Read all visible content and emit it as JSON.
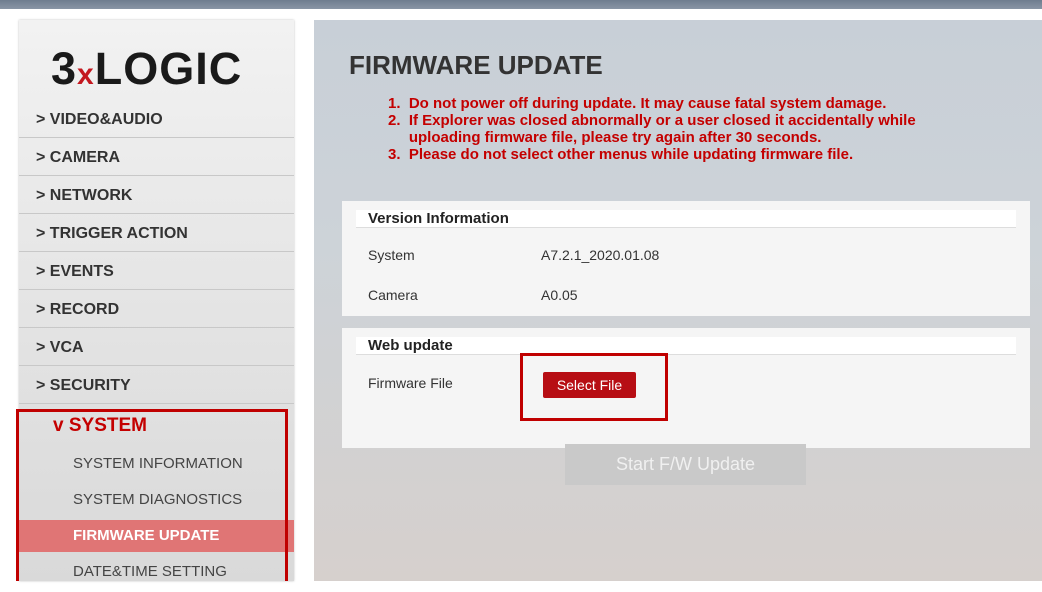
{
  "brand": {
    "logo_prefix": "3",
    "logo_x": "x",
    "logo_suffix": "LOGIC"
  },
  "sidebar": {
    "items": [
      {
        "label": "> VIDEO&AUDIO"
      },
      {
        "label": "> CAMERA"
      },
      {
        "label": "> NETWORK"
      },
      {
        "label": "> TRIGGER ACTION"
      },
      {
        "label": "> EVENTS"
      },
      {
        "label": "> RECORD"
      },
      {
        "label": "> VCA"
      },
      {
        "label": "> SECURITY"
      }
    ],
    "open_item": {
      "label": "v SYSTEM"
    },
    "sub_items": [
      {
        "label": "SYSTEM INFORMATION"
      },
      {
        "label": "SYSTEM DIAGNOSTICS"
      },
      {
        "label": "FIRMWARE UPDATE"
      },
      {
        "label": "DATE&TIME SETTING"
      }
    ],
    "active_sub_item": "FIRMWARE UPDATE"
  },
  "main": {
    "title": "FIRMWARE UPDATE",
    "notes": [
      "1.  Do not power off during update. It may cause fatal system damage.",
      "2.  If Explorer was closed abnormally or a user closed it accidentally while",
      "     uploading firmware file, please try again after 30 seconds.",
      "3.  Please do not select other menus while updating firmware file."
    ],
    "version_panel": {
      "header": "Version Information",
      "rows": [
        {
          "label": "System",
          "value": "A7.2.1_2020.01.08"
        },
        {
          "label": "Camera",
          "value": "A0.05"
        }
      ]
    },
    "web_update_panel": {
      "header": "Web update",
      "field_label": "Firmware File",
      "select_button": "Select File"
    },
    "start_button": "Start F/W Update"
  },
  "colors": {
    "accent_red": "#c40000",
    "button_red": "#b70e14",
    "active_sub_bg": "#e07575",
    "highlight_border": "#c00000"
  }
}
